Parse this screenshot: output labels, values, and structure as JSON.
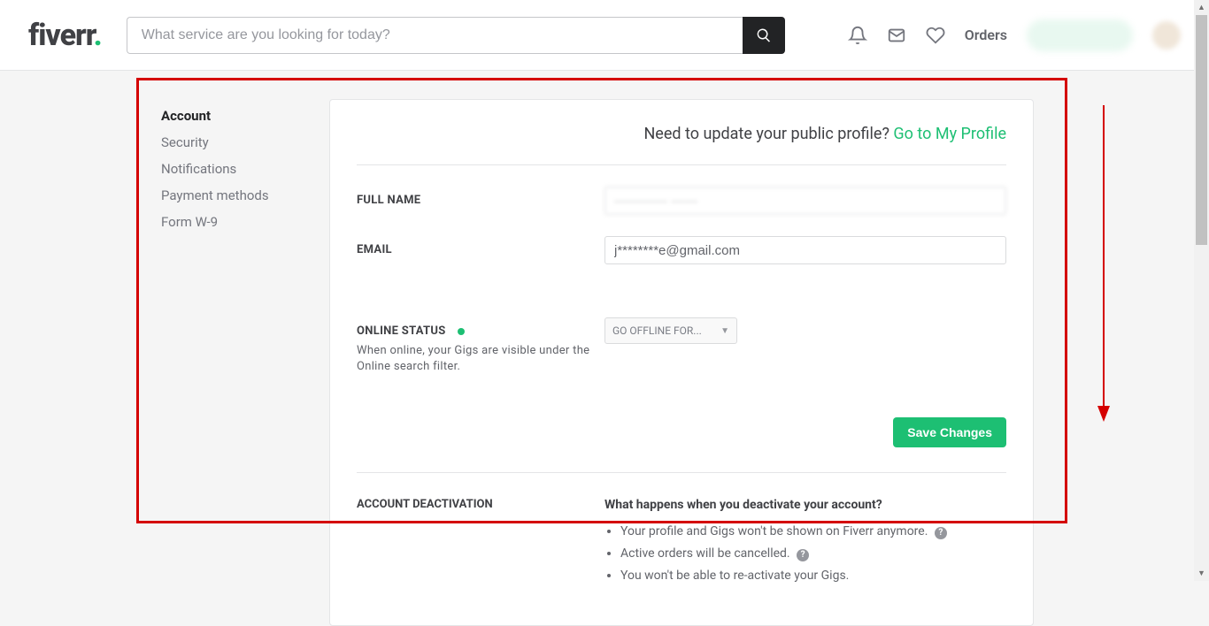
{
  "header": {
    "logo_main": "fiverr",
    "logo_dot": ".",
    "search_placeholder": "What service are you looking for today?",
    "orders": "Orders"
  },
  "sidebar": {
    "items": [
      {
        "label": "Account",
        "active": true
      },
      {
        "label": "Security",
        "active": false
      },
      {
        "label": "Notifications",
        "active": false
      },
      {
        "label": "Payment methods",
        "active": false
      },
      {
        "label": "Form W-9",
        "active": false
      }
    ]
  },
  "main": {
    "profile_prompt": "Need to update your public profile? ",
    "profile_link": "Go to My Profile",
    "full_name_label": "FULL NAME",
    "full_name_value": "———— ——",
    "email_label": "EMAIL",
    "email_value": "j********e@gmail.com",
    "online_status_label": "ONLINE STATUS",
    "online_help": "When online, your Gigs are visible under the Online search filter.",
    "online_select": "GO OFFLINE FOR...",
    "save_btn": "Save Changes",
    "deact_label": "ACCOUNT DEACTIVATION",
    "deact_question": "What happens when you deactivate your account?",
    "deact_items": [
      "Your profile and Gigs won't be shown on Fiverr anymore.",
      "Active orders will be cancelled.",
      "You won't be able to re-activate your Gigs."
    ]
  }
}
